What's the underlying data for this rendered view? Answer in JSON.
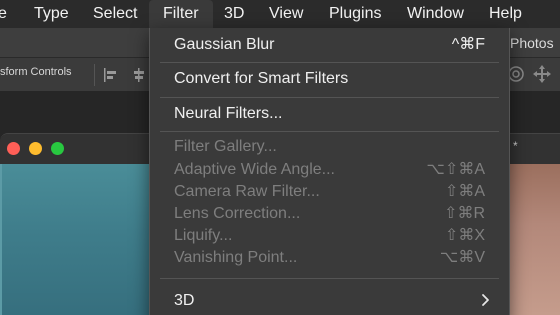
{
  "menubar": {
    "items": [
      "e",
      "Type",
      "Select",
      "Filter",
      "3D",
      "View",
      "Plugins",
      "Window",
      "Help"
    ],
    "active_index": 3
  },
  "options": {
    "transform_label": "sform Controls",
    "workspace_label": "Photos"
  },
  "document": {
    "modified_mark": "*"
  },
  "filter_menu": {
    "gaussian_blur": {
      "label": "Gaussian Blur",
      "shortcut": "^⌘F"
    },
    "convert_smart": {
      "label": "Convert for Smart Filters"
    },
    "neural_filters": {
      "label": "Neural Filters..."
    },
    "filter_gallery": {
      "label": "Filter Gallery..."
    },
    "adaptive_wide": {
      "label": "Adaptive Wide Angle...",
      "shortcut": "⌥⇧⌘A"
    },
    "camera_raw": {
      "label": "Camera Raw Filter...",
      "shortcut": "⇧⌘A"
    },
    "lens_correction": {
      "label": "Lens Correction...",
      "shortcut": "⇧⌘R"
    },
    "liquify": {
      "label": "Liquify...",
      "shortcut": "⇧⌘X"
    },
    "vanishing_point": {
      "label": "Vanishing Point...",
      "shortcut": "⌥⌘V"
    },
    "three_d": {
      "label": "3D"
    }
  },
  "colors": {
    "menu_bg": "#3a3a3a",
    "disabled_text": "#7e7e7e",
    "traffic_red": "#ff5f57",
    "traffic_yellow": "#febc2e",
    "traffic_green": "#28c840"
  },
  "icons": [
    "align-left-icon",
    "align-center-icon",
    "target-icon",
    "move-icon",
    "chevron-right-icon"
  ]
}
